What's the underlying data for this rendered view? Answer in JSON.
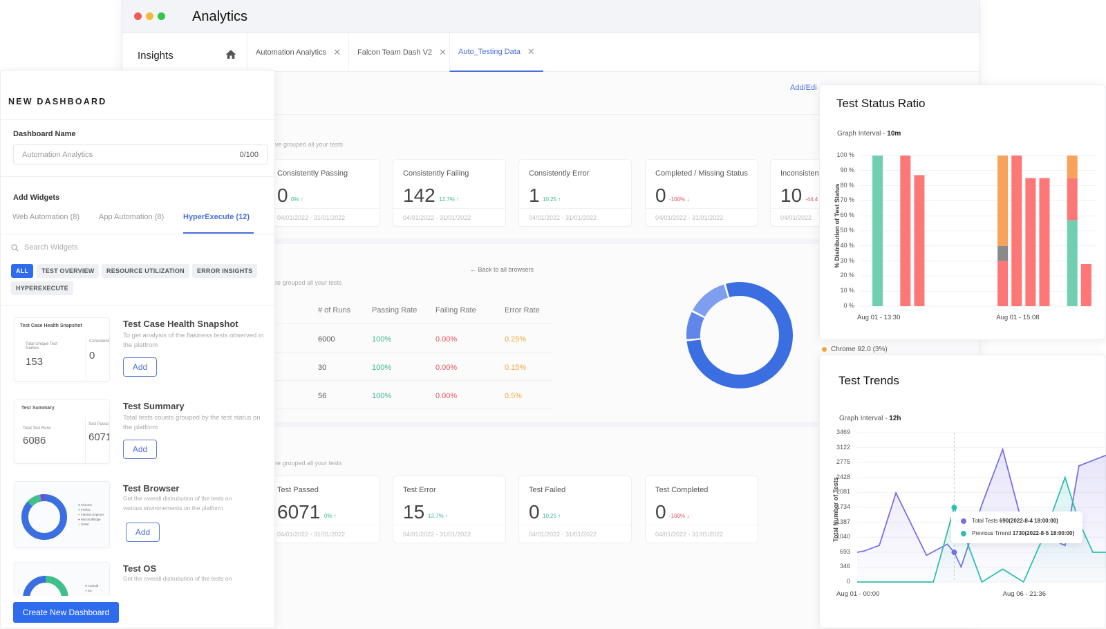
{
  "window": {
    "title": "Analytics"
  },
  "nav": {
    "section": "Insights",
    "tabs": [
      {
        "label": "Automation Analytics",
        "active": false
      },
      {
        "label": "Falcon Team Dash V2",
        "active": false
      },
      {
        "label": "Auto_Testing Data",
        "active": true
      }
    ]
  },
  "panel": {
    "title": "NEW DASHBOARD",
    "dashboard_name_label": "Dashboard Name",
    "dashboard_name_placeholder": "Automation Analytics",
    "dashboard_name_counter": "0/100",
    "add_widgets_label": "Add Widgets",
    "widget_tabs": [
      {
        "label": "Web Automation (8)",
        "active": false
      },
      {
        "label": "App Automation (8)",
        "active": false
      },
      {
        "label": "HyperExecute (12)",
        "active": true
      }
    ],
    "search_placeholder": "Search Widgets",
    "filters": [
      {
        "label": "ALL",
        "active": true
      },
      {
        "label": "TEST OVERVIEW",
        "active": false
      },
      {
        "label": "RESOURCE UTILIZATION",
        "active": false
      },
      {
        "label": "ERROR INSIGHTS",
        "active": false
      },
      {
        "label": "HYPEREXECUTE",
        "active": false
      }
    ],
    "widgets": [
      {
        "name": "Test Case Health Snapshot",
        "desc": "To get analysis of the flakiness tests observed in the platfrom",
        "add": "Add",
        "preview": {
          "title": "Test Case Health Snapshot",
          "label": "Total Unique Test Names",
          "value": "153",
          "side_label": "Consistentl",
          "side_value": "0"
        }
      },
      {
        "name": "Test Summary",
        "desc": "Total tests counts grouped by the test status on the platform",
        "add": "Add",
        "preview": {
          "title": "Test Summary",
          "label": "Total Test Runs",
          "value": "6086",
          "side_label": "Test Passe",
          "side_value": "6071"
        }
      },
      {
        "name": "Test Browser",
        "desc": "Get the overall distrubution of the tests on various environements on the platform",
        "add": "Add",
        "preview": {
          "legend": [
            "Chrome",
            "Firefox",
            "Internet Explorer",
            "MicrosoftEdge",
            "Safari"
          ]
        }
      },
      {
        "name": "Test OS",
        "desc": "Get the overall distrubution of the tests on",
        "preview": {
          "legend": [
            "Android",
            "ios"
          ]
        }
      }
    ],
    "create_button": "Create New Dashboard"
  },
  "main": {
    "add_edit_link": "Add/Edi",
    "health_subtitle": "ve grouped all your tests",
    "health_cards": [
      {
        "title": "Consistently Passing",
        "value": "0",
        "delta": "0% ↑",
        "trend": "up",
        "range": "04/01/2022 - 31/01/2022"
      },
      {
        "title": "Consistently Failing",
        "value": "142",
        "delta": "12.7% ↑",
        "trend": "up",
        "range": "04/01/2022 - 31/01/2022"
      },
      {
        "title": "Consistently Error",
        "value": "1",
        "delta": "10.25 ↑",
        "trend": "up",
        "range": "04/01/2022 - 31/01/2022"
      },
      {
        "title": "Completed / Missing Status",
        "value": "0",
        "delta": "-100% ↓",
        "trend": "down",
        "range": "04/01/2022 - 31/01/2022"
      },
      {
        "title": "Inconsistent",
        "value": "10",
        "delta": "-44.4",
        "trend": "down",
        "range": "04/01/2022"
      }
    ],
    "browser_subtitle": "re grouped all your tests",
    "back_link": "Back to all browsers",
    "table": {
      "headers": [
        "# of Runs",
        "Passing Rate",
        "Failing Rate",
        "Error Rate"
      ],
      "rows": [
        [
          "6000",
          "100%",
          "0.00%",
          "0.25%"
        ],
        [
          "30",
          "100%",
          "0.00%",
          "0.15%"
        ],
        [
          "56",
          "100%",
          "0.00%",
          "0.5%"
        ]
      ]
    },
    "donut": {
      "values": [
        78,
        9,
        13
      ],
      "colors": [
        "#3b6ee0",
        "#5f86e8",
        "#7e9ff0"
      ]
    },
    "chrome_legend": "Chrome 92.0 (3%)",
    "summary_subtitle": "re grouped all your tests",
    "summary_cards": [
      {
        "title": "Test Passed",
        "value": "6071",
        "delta": "0% ↑",
        "trend": "up",
        "range": "04/01/2022 - 31/01/2022"
      },
      {
        "title": "Test Error",
        "value": "15",
        "delta": "12.7% ↑",
        "trend": "up",
        "range": "04/01/2022 - 31/01/2022"
      },
      {
        "title": "Test Failed",
        "value": "0",
        "delta": "10.25 ↑",
        "trend": "up",
        "range": "04/01/2022 - 31/01/2022"
      },
      {
        "title": "Test Completed",
        "value": "0",
        "delta": "-100% ↓",
        "trend": "down",
        "range": "04/01/2022 - 31/01/2022"
      }
    ]
  },
  "chart_data": [
    {
      "type": "bar",
      "title": "Test Status Ratio",
      "interval_label": "Graph Interval - ",
      "interval_value": "10m",
      "ylabel": "% Distribution of Test Status",
      "yticks": [
        "0 %",
        "10 %",
        "20 %",
        "30 %",
        "40 %",
        "50 %",
        "60 %",
        "70 %",
        "80 %",
        "90 %",
        "100 %"
      ],
      "ylim": [
        0,
        100
      ],
      "xticks": [
        {
          "label": "Aug 01 - 13:30",
          "slot": 1
        },
        {
          "label": "Aug 01 - 15:08",
          "slot": 11
        }
      ],
      "slots": 16,
      "colors": {
        "passed": "#6fcfb0",
        "failed": "#fd7777",
        "error": "#f8a25a",
        "other": "#8a8a8a"
      },
      "bars": [
        {
          "slot": 1,
          "stack": [
            {
              "status": "passed",
              "value": 100
            }
          ]
        },
        {
          "slot": 3,
          "stack": [
            {
              "status": "failed",
              "value": 100
            }
          ]
        },
        {
          "slot": 4,
          "stack": [
            {
              "status": "failed",
              "value": 87
            }
          ]
        },
        {
          "slot": 10,
          "stack": [
            {
              "status": "failed",
              "value": 30
            },
            {
              "status": "other",
              "value": 10
            },
            {
              "status": "error",
              "value": 60
            }
          ]
        },
        {
          "slot": 11,
          "stack": [
            {
              "status": "failed",
              "value": 100
            }
          ]
        },
        {
          "slot": 12,
          "stack": [
            {
              "status": "failed",
              "value": 85
            }
          ]
        },
        {
          "slot": 13,
          "stack": [
            {
              "status": "failed",
              "value": 85
            }
          ]
        },
        {
          "slot": 15,
          "stack": [
            {
              "status": "passed",
              "value": 57
            },
            {
              "status": "failed",
              "value": 28
            },
            {
              "status": "error",
              "value": 15
            }
          ]
        },
        {
          "slot": 16,
          "stack": [
            {
              "status": "failed",
              "value": 28
            }
          ]
        }
      ]
    },
    {
      "type": "area",
      "title": "Test Trends",
      "interval_label": "Graph Interval - ",
      "interval_value": "12h",
      "ylabel": "Total Number of Tests",
      "yticks": [
        "0",
        "346",
        "693",
        "1040",
        "1387",
        "1734",
        "2081",
        "2428",
        "2775",
        "3122",
        "3469"
      ],
      "ylim": [
        0,
        3469
      ],
      "xticks": [
        {
          "label": "Aug 01 - 00:00",
          "index": 0
        },
        {
          "label": "Aug 06 - 21:36",
          "index": 12
        }
      ],
      "series": [
        {
          "name": "Total Tests",
          "color": "#7b6fe0",
          "x": [
            0,
            0.5,
            1.6,
            2.8,
            5,
            6.5,
            7,
            7.5,
            9,
            10.5,
            12,
            13.5,
            15,
            16,
            18
          ],
          "values": [
            690,
            720,
            850,
            2070,
            620,
            880,
            690,
            350,
            1800,
            3080,
            1240,
            1060,
            850,
            2700,
            2950
          ]
        },
        {
          "name": "Previous Trrend",
          "color": "#2fbdb3",
          "x": [
            0,
            2,
            4,
            5.5,
            7,
            9,
            10.5,
            12,
            13.5,
            15,
            16,
            17,
            18
          ],
          "values": [
            0,
            0,
            0,
            0,
            1730,
            0,
            300,
            0,
            1100,
            2430,
            1400,
            690,
            690
          ]
        }
      ],
      "hover_index_x": 7,
      "tooltip": [
        {
          "series": "Total Tests",
          "value": "690",
          "time": "(2022-8-4 18:00:00)"
        },
        {
          "series": "Previous Trrend",
          "value": "1730",
          "time": "(2022-8-5 18:00:00)"
        }
      ]
    }
  ]
}
